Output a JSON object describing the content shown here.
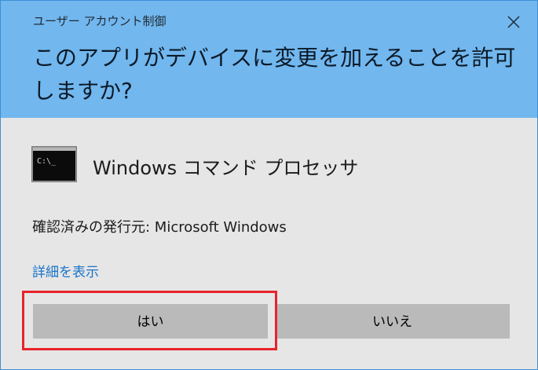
{
  "window": {
    "title": "ユーザー アカウント制御",
    "close_icon": "close-icon"
  },
  "header": {
    "question": "このアプリがデバイスに変更を加えることを許可しますか?",
    "background": "#72b7ee"
  },
  "app": {
    "icon": "command-prompt-icon",
    "icon_text": "C:\\_",
    "name": "Windows コマンド プロセッサ"
  },
  "publisher": {
    "text": "確認済みの発行元: Microsoft Windows"
  },
  "details": {
    "link_label": "詳細を表示"
  },
  "buttons": {
    "yes_label": "はい",
    "no_label": "いいえ"
  },
  "colors": {
    "accent": "#72b7ee",
    "link": "#1a73c9",
    "highlight": "#e8232b",
    "button": "#bababa"
  }
}
